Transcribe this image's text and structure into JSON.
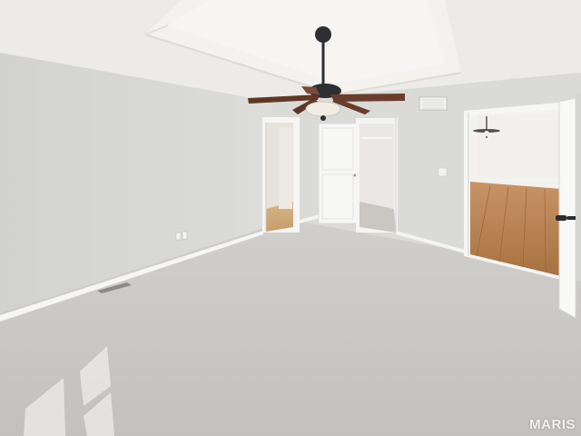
{
  "photo": {
    "watermark": "MARIS"
  },
  "colors": {
    "wall": "#d8d8d4",
    "ceiling": "#ecebe8",
    "carpet": "#c7c6c2",
    "trim": "#f6f6f4",
    "wood_floor": "#b07c4c",
    "fan_blade": "#6a3d2c",
    "fan_metal": "#2d2f33"
  }
}
